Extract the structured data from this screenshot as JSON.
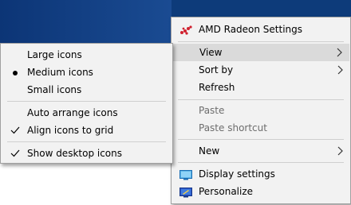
{
  "main_menu": {
    "items": [
      {
        "label": "AMD Radeon Settings",
        "icon": "amd-radeon-icon"
      },
      {
        "label": "View",
        "submenu": true,
        "highlighted": true
      },
      {
        "label": "Sort by",
        "submenu": true
      },
      {
        "label": "Refresh"
      },
      {
        "label": "Paste",
        "disabled": true
      },
      {
        "label": "Paste shortcut",
        "disabled": true
      },
      {
        "label": "New",
        "submenu": true
      },
      {
        "label": "Display settings",
        "icon": "display-settings-icon"
      },
      {
        "label": "Personalize",
        "icon": "personalize-icon"
      }
    ]
  },
  "view_submenu": {
    "items": [
      {
        "label": "Large icons"
      },
      {
        "label": "Medium icons",
        "mark": "dot"
      },
      {
        "label": "Small icons"
      },
      {
        "label": "Auto arrange icons"
      },
      {
        "label": "Align icons to grid",
        "mark": "check"
      },
      {
        "label": "Show desktop icons",
        "mark": "check"
      }
    ]
  },
  "colors": {
    "menu_bg": "#f2f2f2",
    "highlight": "#dadada",
    "disabled_text": "#6d6d6d",
    "amd_red": "#d0202e",
    "desktop_blue": "#0d3b7a"
  }
}
